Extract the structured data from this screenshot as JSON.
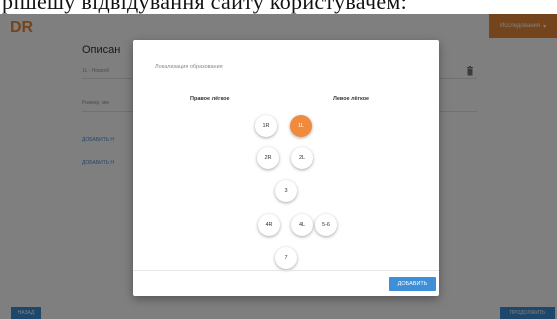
{
  "caption": {
    "text": "рішешу відвідування сайту користувачем:"
  },
  "header": {
    "logo_text": "DR",
    "menu_label": "Исследования",
    "accent_color": "#e98b3a"
  },
  "form": {
    "title": "Описан",
    "field1_value": "1L - Новооб",
    "field2_placeholder": "Размер, мм",
    "add_link1": "ДОБАВИТЬ Н",
    "add_link2": "ДОБАВИТЬ Н"
  },
  "footer": {
    "back_label": "НАЗАД",
    "continue_label": "ПРОДОЛЖИТЬ"
  },
  "modal": {
    "title": "Локализация образования",
    "left_lung_label": "Правое лёгкое",
    "right_lung_label": "Левое лёгкое",
    "lobes": [
      {
        "label": "1R",
        "selected": false
      },
      {
        "label": "1L",
        "selected": true
      },
      {
        "label": "2R",
        "selected": false
      },
      {
        "label": "2L",
        "selected": false
      },
      {
        "label": "3",
        "selected": false
      },
      {
        "label": "4R",
        "selected": false
      },
      {
        "label": "4L",
        "selected": false
      },
      {
        "label": "5-6",
        "selected": false
      },
      {
        "label": "7",
        "selected": false
      }
    ],
    "add_label": "ДОБАВИТЬ",
    "selected_color": "#f08a3c"
  }
}
